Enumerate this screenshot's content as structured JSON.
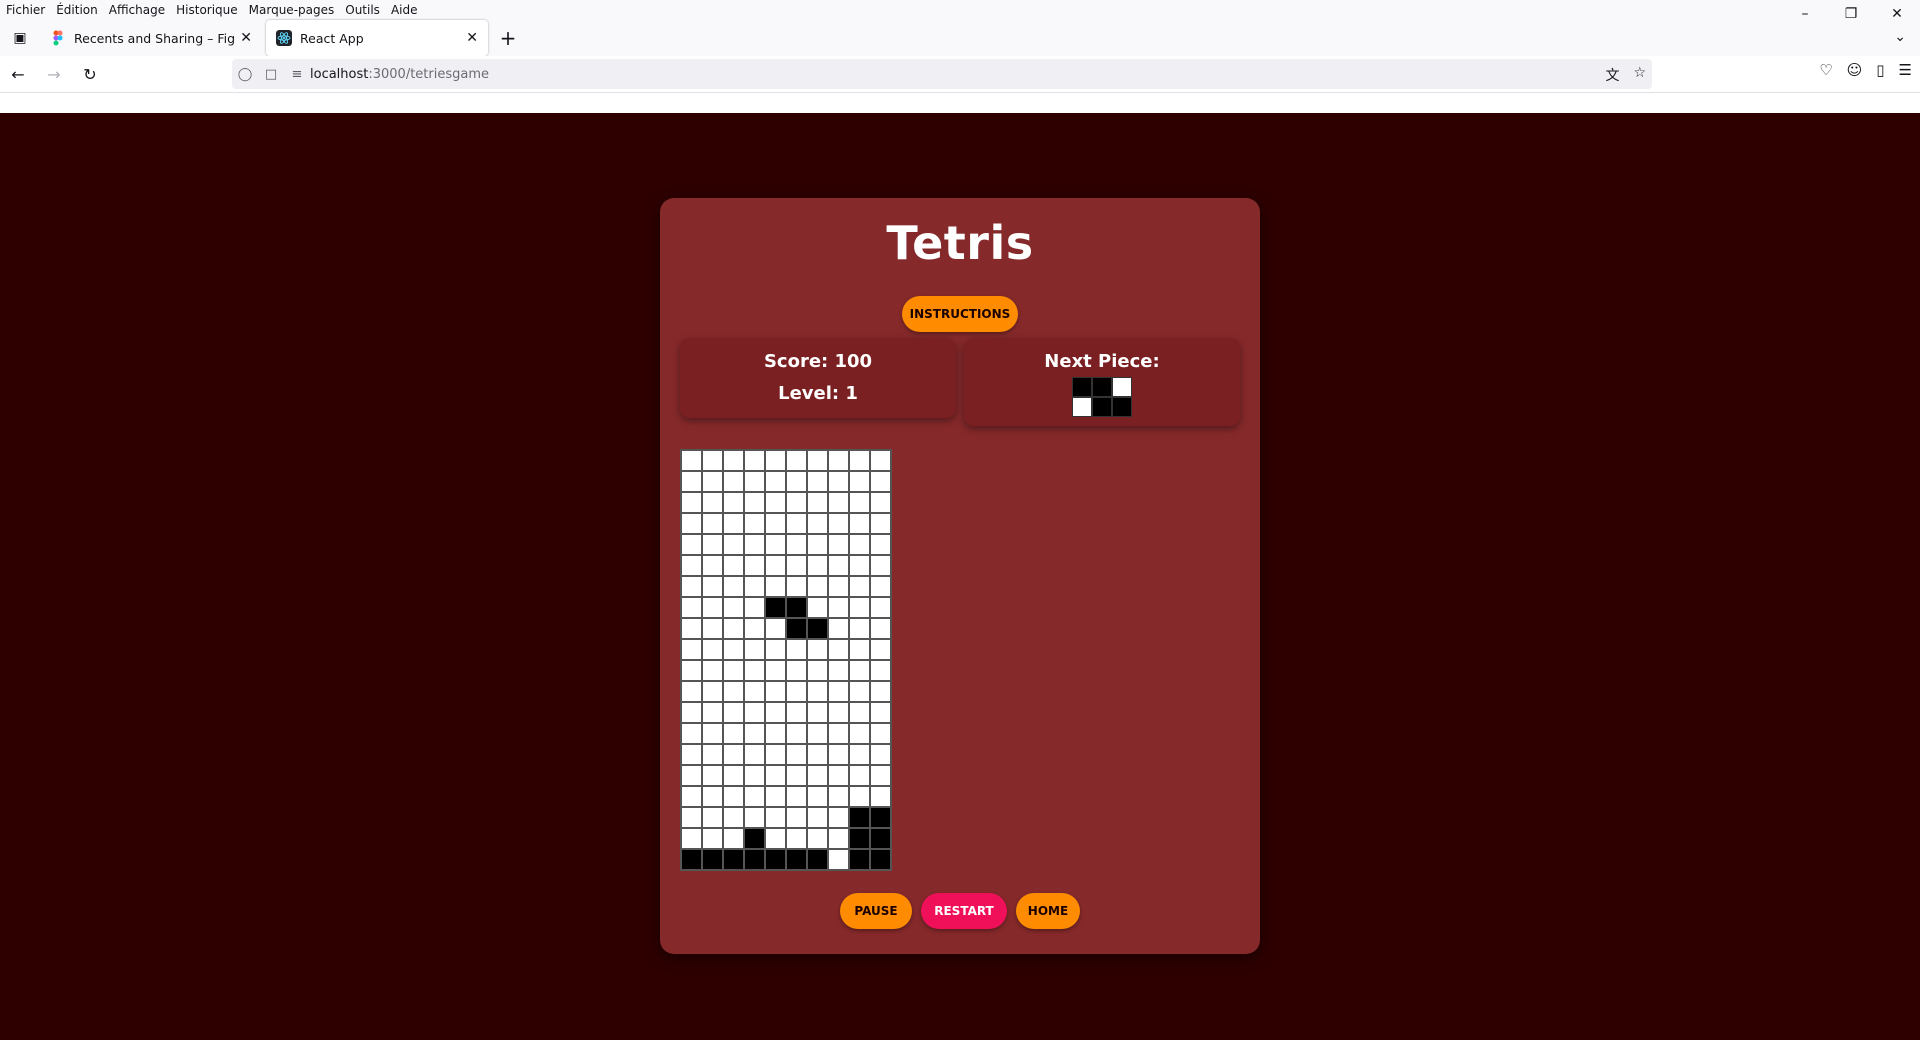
{
  "browser": {
    "menu": [
      "Fichier",
      "Édition",
      "Affichage",
      "Historique",
      "Marque-pages",
      "Outils",
      "Aide"
    ],
    "tabs": [
      {
        "label": "Recents and Sharing – Figma",
        "active": false,
        "icon": "figma-icon"
      },
      {
        "label": "React App",
        "active": true,
        "icon": "react-icon"
      }
    ],
    "url_host": "localhost",
    "url_path": ":3000/tetriesgame"
  },
  "game": {
    "title": "Tetris",
    "instructions_label": "INSTRUCTIONS",
    "score_text": "Score: 100",
    "level_text": "Level: 1",
    "next_piece_label": "Next Piece:",
    "next_piece": [
      [
        1,
        1,
        0
      ],
      [
        0,
        1,
        1
      ]
    ],
    "board": [
      [
        0,
        0,
        0,
        0,
        0,
        0,
        0,
        0,
        0,
        0
      ],
      [
        0,
        0,
        0,
        0,
        0,
        0,
        0,
        0,
        0,
        0
      ],
      [
        0,
        0,
        0,
        0,
        0,
        0,
        0,
        0,
        0,
        0
      ],
      [
        0,
        0,
        0,
        0,
        0,
        0,
        0,
        0,
        0,
        0
      ],
      [
        0,
        0,
        0,
        0,
        0,
        0,
        0,
        0,
        0,
        0
      ],
      [
        0,
        0,
        0,
        0,
        0,
        0,
        0,
        0,
        0,
        0
      ],
      [
        0,
        0,
        0,
        0,
        0,
        0,
        0,
        0,
        0,
        0
      ],
      [
        0,
        0,
        0,
        0,
        1,
        1,
        0,
        0,
        0,
        0
      ],
      [
        0,
        0,
        0,
        0,
        0,
        1,
        1,
        0,
        0,
        0
      ],
      [
        0,
        0,
        0,
        0,
        0,
        0,
        0,
        0,
        0,
        0
      ],
      [
        0,
        0,
        0,
        0,
        0,
        0,
        0,
        0,
        0,
        0
      ],
      [
        0,
        0,
        0,
        0,
        0,
        0,
        0,
        0,
        0,
        0
      ],
      [
        0,
        0,
        0,
        0,
        0,
        0,
        0,
        0,
        0,
        0
      ],
      [
        0,
        0,
        0,
        0,
        0,
        0,
        0,
        0,
        0,
        0
      ],
      [
        0,
        0,
        0,
        0,
        0,
        0,
        0,
        0,
        0,
        0
      ],
      [
        0,
        0,
        0,
        0,
        0,
        0,
        0,
        0,
        0,
        0
      ],
      [
        0,
        0,
        0,
        0,
        0,
        0,
        0,
        0,
        0,
        0
      ],
      [
        0,
        0,
        0,
        0,
        0,
        0,
        0,
        0,
        1,
        1
      ],
      [
        0,
        0,
        0,
        1,
        0,
        0,
        0,
        0,
        1,
        1
      ],
      [
        1,
        1,
        1,
        1,
        1,
        1,
        1,
        0,
        1,
        1
      ]
    ],
    "pause_label": "PAUSE",
    "restart_label": "RESTART",
    "home_label": "HOME"
  },
  "colors": {
    "page_bg": "#2e0000",
    "card_bg": "#86292b",
    "panel_bg": "#7b2022",
    "orange": "#ff8c00",
    "pink": "#f0105a"
  }
}
